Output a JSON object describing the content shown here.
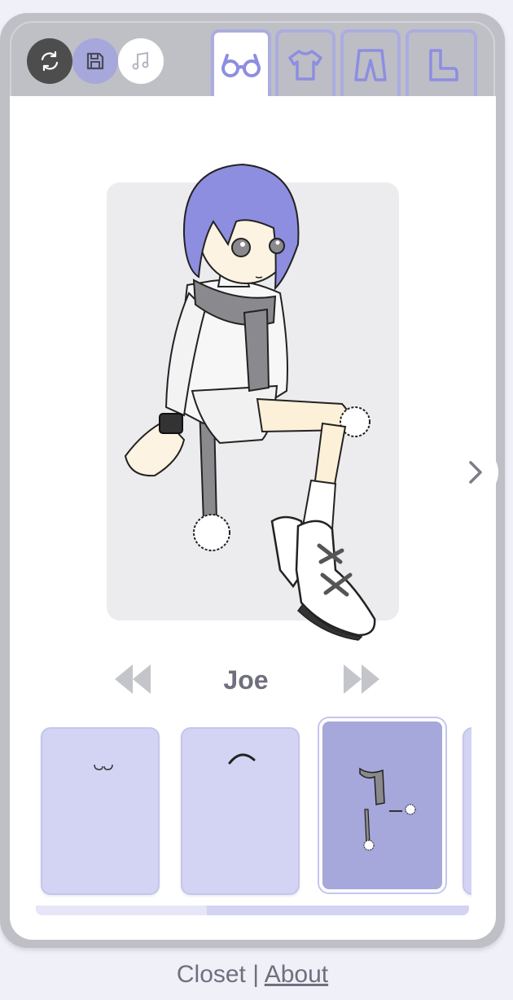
{
  "app": {
    "title": "Closet"
  },
  "toolbar": {
    "buttons": [
      {
        "name": "refresh",
        "icon": "refresh-icon"
      },
      {
        "name": "save",
        "icon": "save-icon"
      },
      {
        "name": "music",
        "icon": "music-note-icon"
      }
    ]
  },
  "tabs": [
    {
      "name": "accessories",
      "icon": "glasses-icon",
      "active": true
    },
    {
      "name": "tops",
      "icon": "shirt-icon",
      "active": false
    },
    {
      "name": "bottoms",
      "icon": "pants-icon",
      "active": false
    },
    {
      "name": "shoes",
      "icon": "boot-icon",
      "active": false
    }
  ],
  "character": {
    "name": "Joe"
  },
  "items": [
    {
      "name": "item-1",
      "selected": false
    },
    {
      "name": "item-2",
      "selected": false
    },
    {
      "name": "item-3-scarf",
      "selected": true
    }
  ],
  "scroll": {
    "position": 0.4
  },
  "footer": {
    "link_closet": "Closet",
    "separator": " | ",
    "link_about": "About"
  },
  "colors": {
    "accent": "#a6a7da",
    "accent_light": "#d3d3f3",
    "frame": "#bfbfc6",
    "hair": "#8d8ee0",
    "text": "#6f6f7e"
  }
}
